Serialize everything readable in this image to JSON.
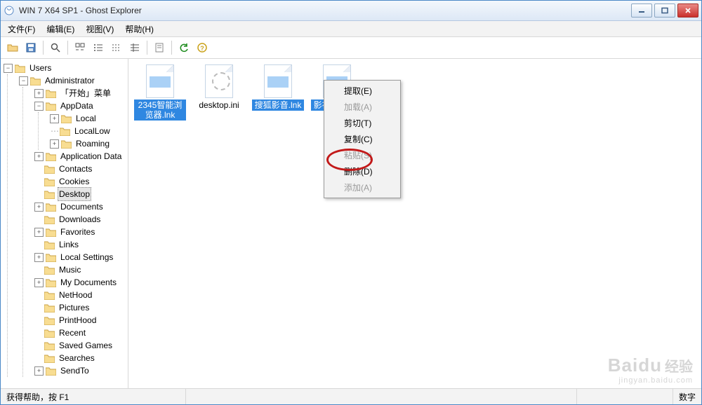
{
  "window": {
    "title": "WIN 7 X64 SP1 - Ghost Explorer"
  },
  "menu": {
    "file": "文件(F)",
    "edit": "编辑(E)",
    "view": "视图(V)",
    "help": "帮助(H)"
  },
  "tree": {
    "root": "Users",
    "admin": "Administrator",
    "start_menu": "「开始」菜单",
    "appdata": "AppData",
    "local": "Local",
    "locallow": "LocalLow",
    "roaming": "Roaming",
    "application_data": "Application Data",
    "contacts": "Contacts",
    "cookies": "Cookies",
    "desktop": "Desktop",
    "documents": "Documents",
    "downloads": "Downloads",
    "favorites": "Favorites",
    "links": "Links",
    "local_settings": "Local Settings",
    "music": "Music",
    "my_documents": "My Documents",
    "nethood": "NetHood",
    "pictures": "Pictures",
    "printhood": "PrintHood",
    "recent": "Recent",
    "saved_games": "Saved Games",
    "searches": "Searches",
    "sendto": "SendTo"
  },
  "files": [
    {
      "name": "2345智能浏览器.lnk",
      "selected": true,
      "style": "band"
    },
    {
      "name": "desktop.ini",
      "selected": false,
      "style": "ini"
    },
    {
      "name": "搜狐影音.lnk",
      "selected": true,
      "style": "band"
    },
    {
      "name": "影视大全.lnk",
      "selected": true,
      "style": "band"
    }
  ],
  "context": {
    "extract": "提取(E)",
    "load": "加载(A)",
    "cut": "剪切(T)",
    "copy": "复制(C)",
    "paste": "粘贴(S)",
    "delete": "删除(D)",
    "add": "添加(A)"
  },
  "status": {
    "help": "获得帮助，按 F1",
    "num": "数字"
  },
  "watermark": {
    "brand": "Baidu",
    "cn": "经验",
    "url": "jingyan.baidu.com"
  },
  "colors": {
    "select_bg": "#2f87e1",
    "annotation": "#c21919"
  }
}
